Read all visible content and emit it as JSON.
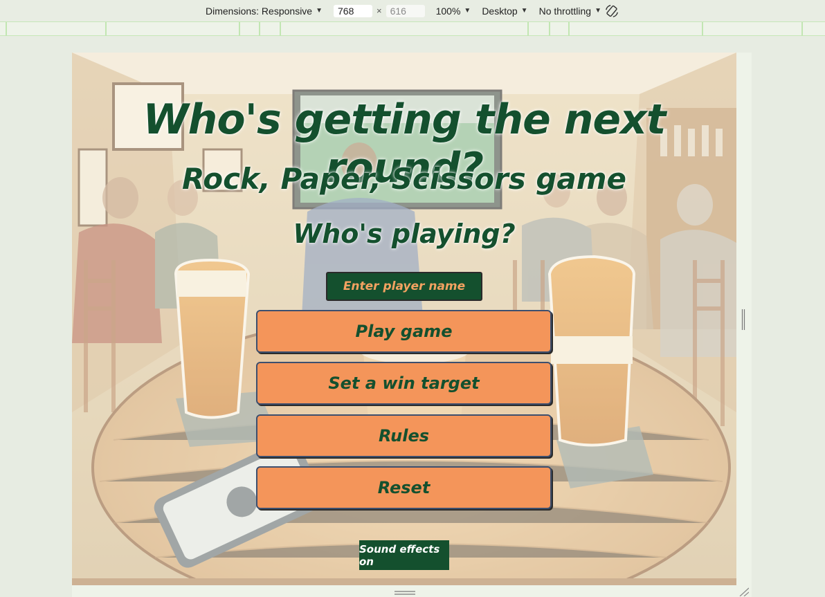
{
  "devtools": {
    "dimensions_label": "Dimensions: Responsive",
    "width_value": "768",
    "height_value": "616",
    "times": "×",
    "zoom": "100%",
    "device": "Desktop",
    "throttling": "No throttling",
    "rotate_icon": "rotate-icon"
  },
  "game": {
    "title": "Who's getting the next round?",
    "subtitle": "Rock, Paper, Scissors game",
    "question": "Who's playing?",
    "name_placeholder": "Enter player name",
    "buttons": {
      "play": "Play game",
      "win_target": "Set a win target",
      "rules": "Rules",
      "reset": "Reset"
    },
    "sound_toggle": "Sound effects on"
  },
  "colors": {
    "dark_green": "#14502e",
    "orange": "#f4955a",
    "page_bg": "#e7ece2"
  }
}
